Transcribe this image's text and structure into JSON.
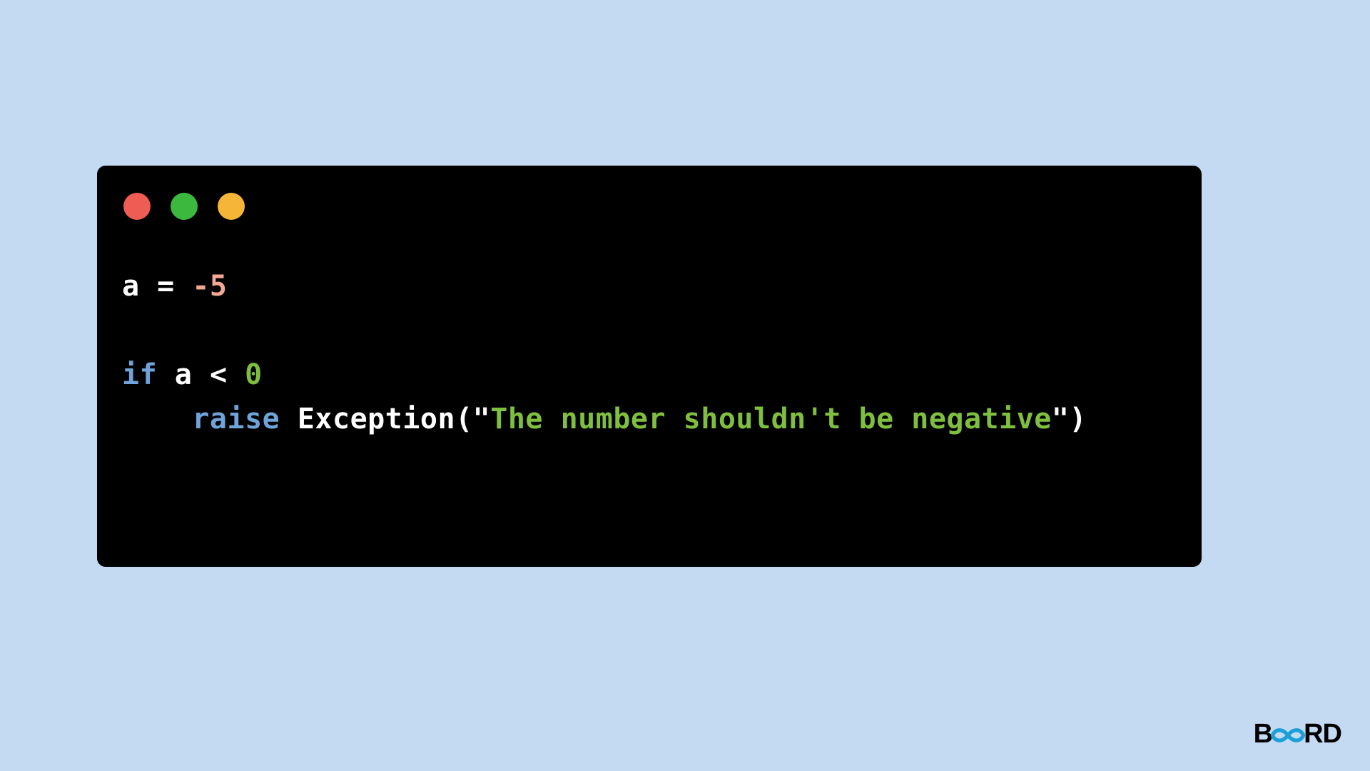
{
  "code": {
    "line1": {
      "var": "a",
      "assign": " = ",
      "value": "-5"
    },
    "line3": {
      "keyword": "if",
      "space1": " ",
      "var": "a",
      "op": " < ",
      "zero": "0"
    },
    "line4": {
      "indent": "    ",
      "keyword": "raise",
      "space1": " ",
      "func": "Exception(",
      "quote1": "\"",
      "string": "The number shouldn't be negative",
      "quote2": "\"",
      "paren": ")"
    }
  },
  "brand": {
    "b": "B",
    "rd": "RD"
  },
  "colors": {
    "background": "#c4d9f2",
    "code_bg": "#000000",
    "red_dot": "#ee5c54",
    "green_dot": "#3bb93f",
    "yellow_dot": "#f5b638",
    "text_white": "#ffffff",
    "text_orange": "#f5a894",
    "text_blue": "#6fa3d9",
    "text_green": "#7fbf3f",
    "brand_accent": "#1a9fd9"
  }
}
